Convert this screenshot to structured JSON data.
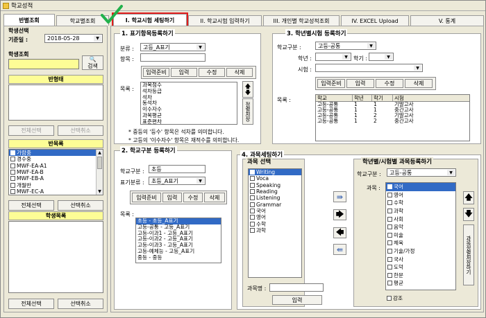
{
  "window": {
    "title": "학교성적"
  },
  "tabs": {
    "left": [
      "반별조회",
      "학교별조회"
    ],
    "main": [
      "I. 학교시험 세팅하기",
      "II. 학교시험 입력하기",
      "III. 개인별 학교성적조회",
      "IV. EXCEL Upload",
      "V. 통계"
    ]
  },
  "left": {
    "student_select": "학생선택",
    "base_date_label": "기준일 :",
    "base_date": "2018-05-28",
    "student_search": "학생조회",
    "search_btn": "검색",
    "class_type": "반형태",
    "select_all": "전체선택",
    "deselect": "선택취소",
    "class_list_title": "반목록",
    "class_items": [
      "가람중",
      "경수중",
      "MWF-EA-A1",
      "MWF-EA-B",
      "MWF-EB-A",
      "개월반",
      "MWF-EC-A"
    ],
    "student_list_title": "학생목록"
  },
  "sec1": {
    "title": "1. 표기항목등록하기",
    "cat_label": "분류 :",
    "cat_value": "고등_A표기",
    "item_label": "항목 :",
    "buttons": [
      "입력준비",
      "입력",
      "수정",
      "삭제"
    ],
    "list_label": "목록 :",
    "items": [
      "과목점수",
      "석차등급",
      "석차",
      "동석차",
      "이수자수",
      "과목평균",
      "표준편차"
    ],
    "save_order": "정렬저장",
    "note1": "* 중등의 '등수' 항목은 석차를 의미합니다.",
    "note2": "* 고등의 '이수자수' 항목은 재적수를 의미합니다."
  },
  "sec2": {
    "title": "2. 학교구분 등록하기",
    "school_type_label": "학교구분 :",
    "school_type": "초등",
    "mark_label": "표기분류 :",
    "mark_value": "초등_A표기",
    "buttons": [
      "입력준비",
      "입력",
      "수정",
      "삭제"
    ],
    "list_label": "목록 :",
    "items": [
      "초등 - 초등_A표기",
      "고등-공통 - 고등_A표기",
      "고등-이과1 - 고등_A표기",
      "고등-이과2 - 고등_A표기",
      "고등-이과3 - 고등_A표기",
      "고등-예체능 - 고등_A표기",
      "중등 - 중등"
    ]
  },
  "sec3": {
    "title": "3. 학년별시험 등록하기",
    "school_type_label": "학교구분 :",
    "school_type": "고등-공통",
    "grade_label": "학년 :",
    "term_label": "학기 :",
    "exam_label": "시험 :",
    "buttons": [
      "입력준비",
      "입력",
      "수정",
      "삭제"
    ],
    "list_label": "목록 :",
    "columns": [
      "학교",
      "학년",
      "학기",
      "시험"
    ],
    "rows": [
      [
        "고등-공통",
        "1",
        "1",
        "기말고사"
      ],
      [
        "고등-공통",
        "1",
        "1",
        "중간고사"
      ],
      [
        "고등-공통",
        "1",
        "2",
        "기말고사"
      ],
      [
        "고등-공통",
        "1",
        "2",
        "중간고사"
      ]
    ]
  },
  "sec4": {
    "title": "4. 과목세팅하기",
    "subject_select": "과목 선택",
    "subjects": [
      "Writing",
      "Voca",
      "Speaking",
      "Reading",
      "Listening",
      "Grammar",
      "국어",
      "영어",
      "수학",
      "과학"
    ],
    "subject_name_label": "과목명 :",
    "input_btn": "입력",
    "grade_exam_title": "학년별/시험별 과목등록하기",
    "school_type_label": "학교구분 :",
    "school_type": "고등-공통",
    "subjects_label": "과목 :",
    "reg_subjects": [
      "국어",
      "영어",
      "수학",
      "과학",
      "사회",
      "음악",
      "미술",
      "체육",
      "기술/가정",
      "국사",
      "도덕",
      "한문",
      "평균"
    ],
    "save_order": "과목정렬저장하기",
    "emphasis": "강조"
  },
  "colors": {
    "yellow": "#fdfd96",
    "highlight": "#316ac5",
    "red_box": "#e21d1d",
    "check_green": "#22b14c"
  }
}
